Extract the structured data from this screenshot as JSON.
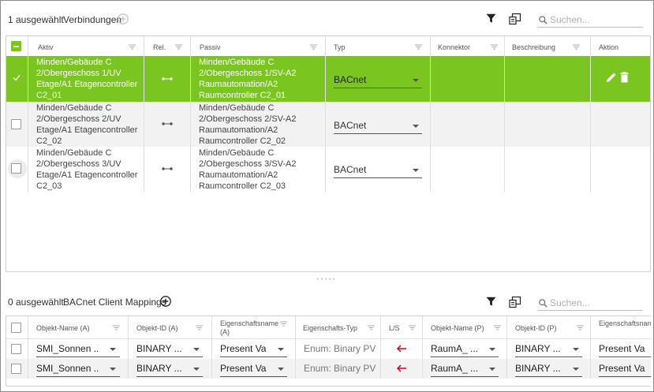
{
  "colors": {
    "accent": "#7ac520",
    "stripe": "#f2f2f2",
    "arrow": "#d0021b"
  },
  "top_toolbar": {
    "selected_count": "1 ausgewählt",
    "title": "Verbindungen",
    "search_placeholder": "Suchen..."
  },
  "top_table": {
    "columns": [
      "Aktiv",
      "Rel.",
      "Passiv",
      "Typ",
      "Konnektor",
      "Beschreibung",
      "Aktion"
    ],
    "rows": [
      {
        "aktiv": [
          "Minden/Gebäude C",
          "2/Obergeschoss 1/UV",
          "Etage/A1 Etagencontroller",
          "C2_01"
        ],
        "passiv": [
          "Minden/Gebäude C",
          "2/Obergeschoss 1/SV-A2",
          "Raumautomation/A2",
          "Raumcontroller C2_01"
        ],
        "typ": "BACnet",
        "selected": true
      },
      {
        "aktiv": [
          "Minden/Gebäude C",
          "2/Obergeschoss 2/UV",
          "Etage/A1 Etagencontroller",
          "C2_02"
        ],
        "passiv": [
          "Minden/Gebäude C",
          "2/Obergeschoss 2/SV-A2",
          "Raumautomation/A2",
          "Raumcontroller C2_02"
        ],
        "typ": "BACnet",
        "selected": false
      },
      {
        "aktiv": [
          "Minden/Gebäude C",
          "2/Obergeschoss 3/UV",
          "Etage/A1 Etagencontroller",
          "C2_03"
        ],
        "passiv": [
          "Minden/Gebäude C",
          "2/Obergeschoss 3/SV-A2",
          "Raumautomation/A2",
          "Raumcontroller C2_03"
        ],
        "typ": "BACnet",
        "selected": false
      }
    ]
  },
  "bottom_toolbar": {
    "selected_count": "0 ausgewählt",
    "title": "BACnet Client Mappings",
    "search_placeholder": "Suchen..."
  },
  "bottom_table": {
    "columns": [
      "Objekt-Name (A)",
      "Objekt-ID (A)",
      "Eigenschaftsname (A)",
      "Eigenschafts-Typ",
      "L/S",
      "Objekt-Name (P)",
      "Objekt-ID (P)",
      "Eigenschaftsname (P)"
    ],
    "rows": [
      {
        "obj_name_a": "SMI_Sonnen ...",
        "obj_id_a": "BINARY ...",
        "prop_a": "Present Va",
        "prop_type": "Enum: Binary PV",
        "obj_name_p": "RaumA_ ...",
        "obj_id_p": "BINARY ...",
        "prop_p": "Present Va"
      },
      {
        "obj_name_a": "SMI_Sonnen ...",
        "obj_id_a": "BINARY ...",
        "prop_a": "Present Va",
        "prop_type": "Enum: Binary PV",
        "obj_name_p": "RaumA_ ...",
        "obj_id_p": "BINARY ...",
        "prop_p": "Present Va"
      }
    ]
  }
}
